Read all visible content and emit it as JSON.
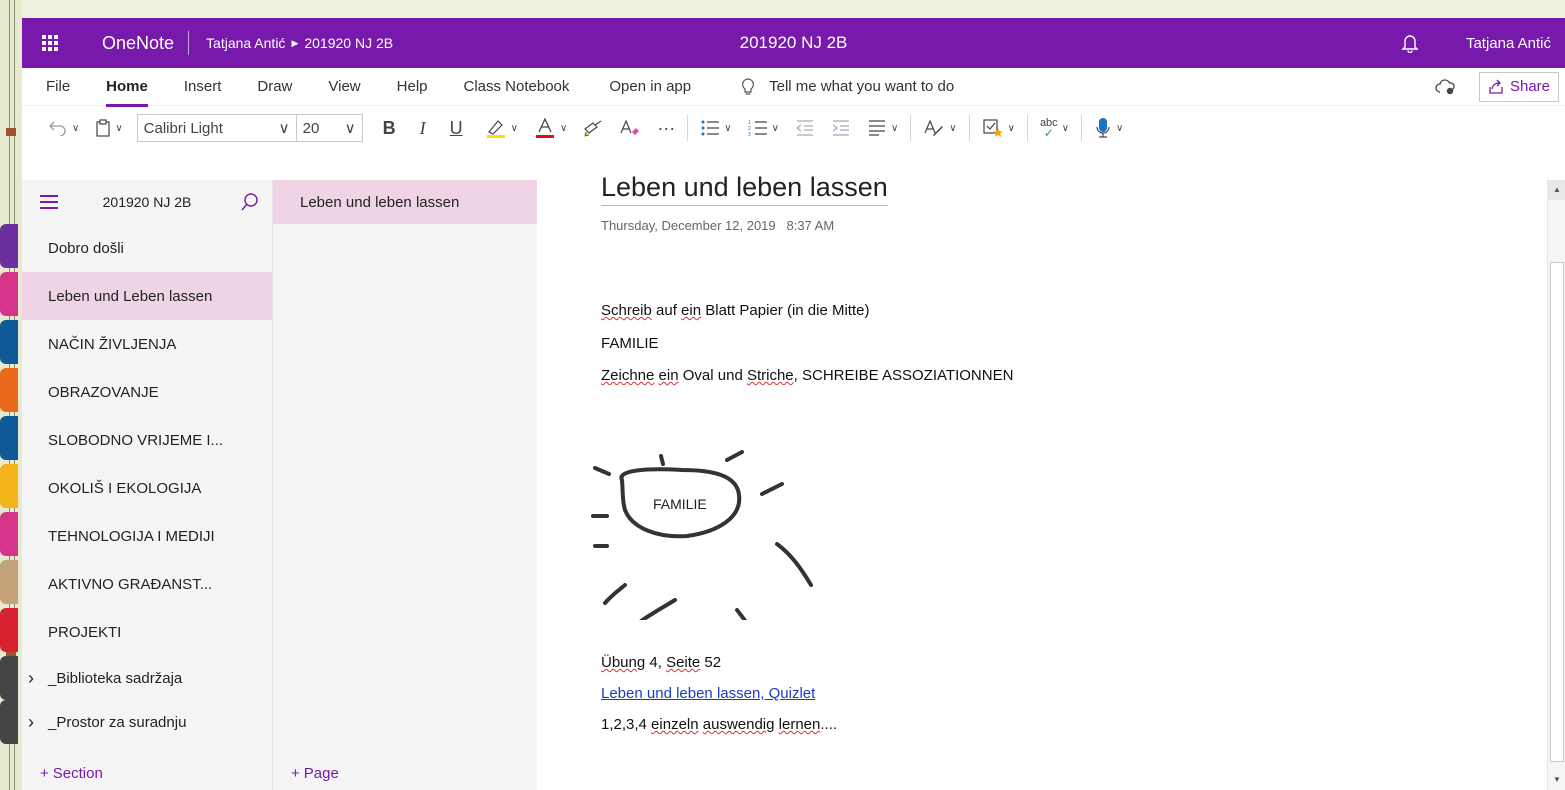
{
  "header": {
    "app_name": "OneNote",
    "breadcrumb_user": "Tatjana Antić",
    "breadcrumb_notebook": "201920 NJ 2B",
    "center_title": "201920 NJ 2B",
    "user_name": "Tatjana Antić",
    "accent_color": "#7719aa"
  },
  "ribbon": {
    "tabs": [
      "File",
      "Home",
      "Insert",
      "Draw",
      "View",
      "Help",
      "Class Notebook",
      "Open in app"
    ],
    "active_tab": "Home",
    "tell_me": "Tell me what you want to do",
    "share_label": "Share"
  },
  "toolbar": {
    "font_name": "Calibri Light",
    "font_size": "20",
    "bold": "B",
    "italic": "I",
    "underline": "U",
    "more": "···",
    "spell_label": "abc"
  },
  "navigation": {
    "notebook_name": "201920 NJ 2B",
    "sections": [
      {
        "label": "Dobro došli",
        "color": "#6b2fa0"
      },
      {
        "label": "Leben und Leben lassen",
        "color": "#d6338a"
      },
      {
        "label": "NAČIN ŽIVLJENJA",
        "color": "#0f5a96"
      },
      {
        "label": "OBRAZOVANJE",
        "color": "#ea6a1d"
      },
      {
        "label": "SLOBODNO VRIJEME I...",
        "color": "#0f5a96"
      },
      {
        "label": "OKOLIŠ I EKOLOGIJA",
        "color": "#f2b31b"
      },
      {
        "label": "TEHNOLOGIJA I MEDIJI",
        "color": "#d6338a"
      },
      {
        "label": "AKTIVNO GRAĐANST...",
        "color": "#c4a27a"
      },
      {
        "label": "PROJEKTI",
        "color": "#d8222f"
      },
      {
        "label": "_Biblioteka sadržaja",
        "color": "#444444"
      },
      {
        "label": "_Prostor za suradnju",
        "color": "#444444"
      }
    ],
    "selected_section": "Leben und Leben lassen",
    "add_section": "Section",
    "add_page": "Page"
  },
  "pages": {
    "items": [
      "Leben und leben lassen"
    ]
  },
  "page": {
    "title": "Leben und leben lassen",
    "date": "Thursday, December 12, 2019",
    "time": "8:37 AM",
    "line1_parts": [
      "Schreib",
      " auf ",
      "ein",
      " Blatt Papier (in die Mitte)"
    ],
    "line2": "FAMILIE",
    "line3_parts": [
      "Zeichne",
      " ",
      "ein",
      " Oval und ",
      "Striche",
      ", SCHREIBE ASSOZIATIONNEN"
    ],
    "drawing_label": "FAMILIE",
    "line4_parts": [
      "Übung",
      " 4, ",
      "Seite",
      " 52"
    ],
    "link_text": "Leben und leben lassen, Quizlet",
    "line6_parts": [
      "1,2,3,4 ",
      "einzeln",
      " ",
      "auswendig",
      " ",
      "lernen",
      "...."
    ]
  }
}
